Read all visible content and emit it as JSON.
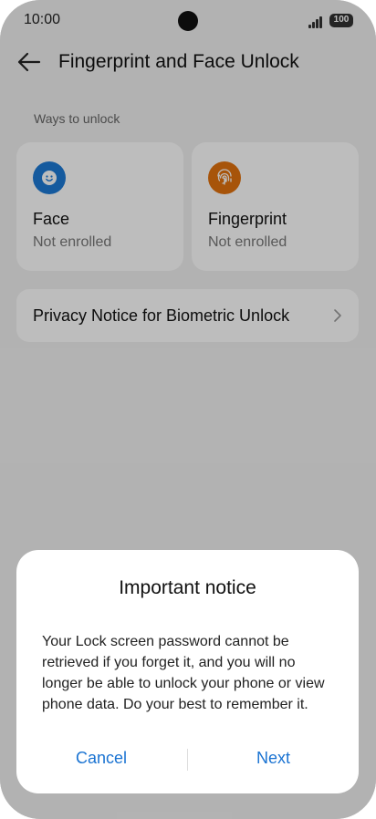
{
  "status_bar": {
    "time": "10:00",
    "battery": "100"
  },
  "header": {
    "title": "Fingerprint and Face Unlock"
  },
  "section": {
    "label": "Ways to unlock"
  },
  "unlock_methods": [
    {
      "name": "Face",
      "status": "Not enrolled",
      "icon": "face-icon",
      "color": "#1d7ad6"
    },
    {
      "name": "Fingerprint",
      "status": "Not enrolled",
      "icon": "fingerprint-icon",
      "color": "#e2720e"
    }
  ],
  "privacy_row": {
    "label": "Privacy Notice for Biometric Unlock"
  },
  "dialog": {
    "title": "Important notice",
    "body": "Your Lock screen password cannot be retrieved if you forget it, and you will no longer be able to unlock your phone or view phone data. Do your best to remember it.",
    "cancel_label": "Cancel",
    "next_label": "Next",
    "accent_color": "#1a73d2"
  }
}
